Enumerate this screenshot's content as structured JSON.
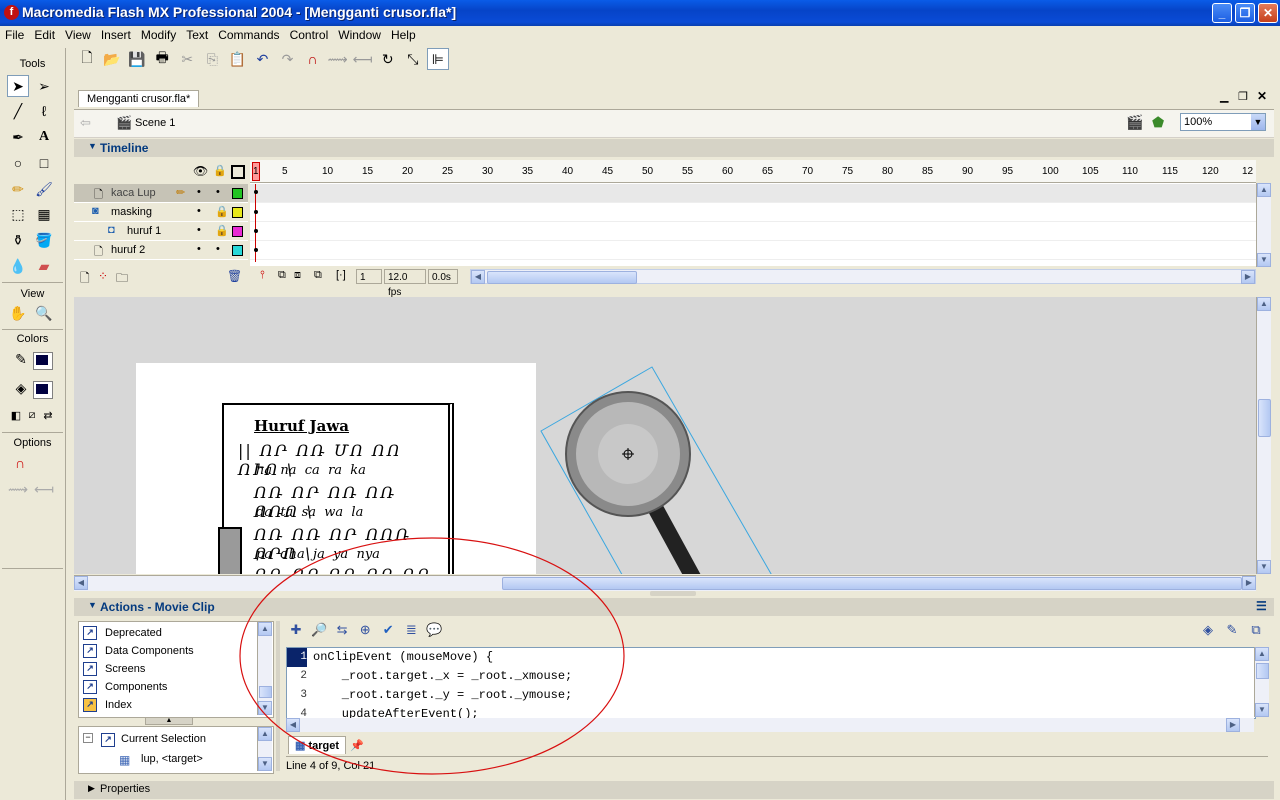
{
  "window": {
    "title": "Macromedia Flash MX Professional 2004 - [Mengganti crusor.fla*]",
    "logo_letter": "f",
    "min": "_",
    "max": "❐",
    "close": "✕"
  },
  "menu": [
    "File",
    "Edit",
    "View",
    "Insert",
    "Modify",
    "Text",
    "Commands",
    "Control",
    "Window",
    "Help"
  ],
  "tools": {
    "heading": "Tools",
    "view_heading": "View",
    "colors_heading": "Colors",
    "options_heading": "Options"
  },
  "document": {
    "tab": "Mengganti crusor.fla*",
    "scene": "Scene 1",
    "zoom": "100%"
  },
  "timeline": {
    "heading": "Timeline",
    "frame_numbers": [
      "1",
      "5",
      "10",
      "15",
      "20",
      "25",
      "30",
      "35",
      "40",
      "45",
      "50",
      "55",
      "60",
      "65",
      "70",
      "75",
      "80",
      "85",
      "90",
      "95",
      "100",
      "105",
      "110",
      "115",
      "120",
      "12"
    ],
    "layers": [
      {
        "name": "kaca Lup",
        "color": "#22c322",
        "selected": true
      },
      {
        "name": "masking",
        "color": "#e8e81a",
        "selected": false
      },
      {
        "name": "huruf 1",
        "color": "#e82ad4",
        "selected": false
      },
      {
        "name": "huruf 2",
        "color": "#28d8d8",
        "selected": false
      }
    ],
    "current_frame": "1",
    "fps": "12.0 fps",
    "elapsed": "0.0s"
  },
  "stage": {
    "book_title": "Huruf Jawa",
    "book_rows": [
      "ha  na  ca  ra  ka",
      "da  ta  sa  wa  la",
      "pa  dha  ja  ya  nya"
    ]
  },
  "actions": {
    "heading": "Actions - Movie Clip",
    "toolbox": [
      "Deprecated",
      "Data Components",
      "Screens",
      "Components",
      "Index"
    ],
    "nav": {
      "current_selection": "Current Selection",
      "item": "lup, <target>"
    },
    "code": [
      "onClipEvent (mouseMove) {",
      "    _root.target._x = _root._xmouse;",
      "    _root.target._y = _root._ymouse;",
      "    updateAfterEvent();"
    ],
    "line_numbers": [
      "1",
      "2",
      "3",
      "4"
    ],
    "script_tab": "target",
    "status": "Line 4 of 9, Col 21"
  },
  "properties": {
    "heading": "Properties"
  }
}
